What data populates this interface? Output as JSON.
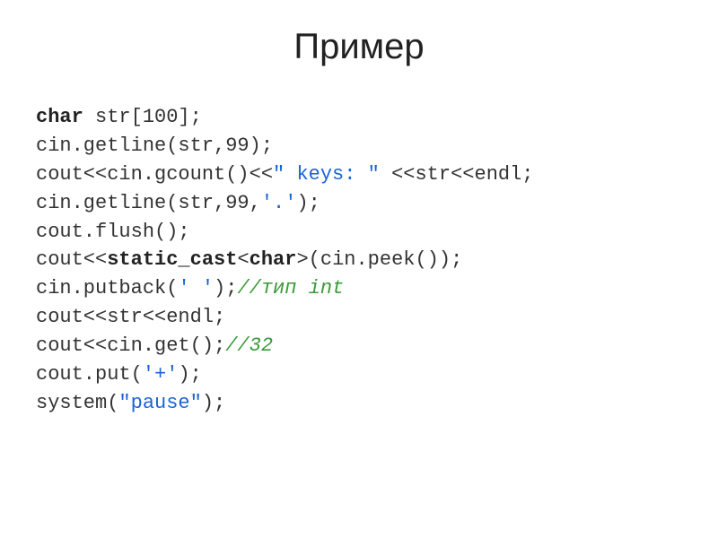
{
  "title": "Пример",
  "code": {
    "l1_kw": "char",
    "l1_rest": " str[100];",
    "l2": "cin.getline(str,99);",
    "l3a": "cout<<cin.gcount()<<",
    "l3str": "\" keys: \"",
    "l3b": " <<str<<endl;",
    "l4a": "cin.getline(str,99,",
    "l4chr": "'.'",
    "l4b": ");",
    "l5": "cout.flush();",
    "l6a": "cout<<",
    "l6kw1": "static_cast",
    "l6mid": "<",
    "l6kw2": "char",
    "l6b": ">(cin.peek());",
    "l7a": "cin.putback(",
    "l7chr": "' '",
    "l7b": ");",
    "l7com": "//тип int",
    "l8": "cout<<str<<endl;",
    "l9a": "cout<<cin.get();",
    "l9com": "//32",
    "l10a": "cout.put(",
    "l10chr": "'+'",
    "l10b": ");",
    "l11a": "system(",
    "l11str": "\"pause\"",
    "l11b": ");"
  }
}
